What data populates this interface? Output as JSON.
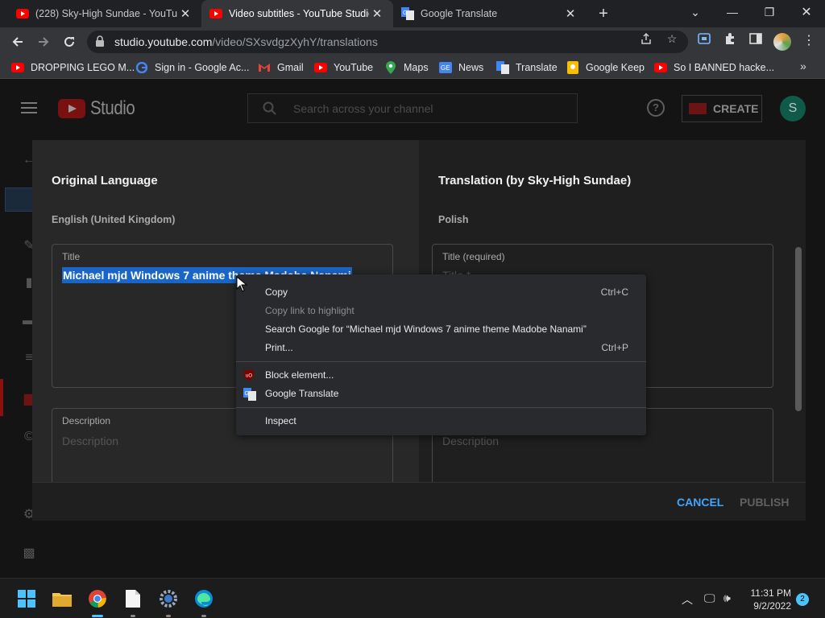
{
  "browser": {
    "tabs": [
      {
        "title": "(228) Sky-High Sundae - YouTube",
        "active": false
      },
      {
        "title": "Video subtitles - YouTube Studio",
        "active": true
      },
      {
        "title": "Google Translate",
        "active": false
      }
    ],
    "url_host": "studio.youtube.com",
    "url_path": "/video/SXsvdgzXyhY/translations",
    "bookmarks": [
      "DROPPING LEGO M...",
      "Sign in - Google Ac...",
      "Gmail",
      "YouTube",
      "Maps",
      "News",
      "Translate",
      "Google Keep",
      "So I BANNED hacke..."
    ]
  },
  "studio": {
    "logo_text": "Studio",
    "search_placeholder": "Search across your channel",
    "create_label": "CREATE",
    "avatar_letter": "S",
    "help_glyph": "?"
  },
  "dialog": {
    "left": {
      "heading": "Original Language",
      "language": "English (United Kingdom)",
      "title_label": "Title",
      "title_value": "Michael mjd Windows 7 anime theme Madobe Nanami",
      "description_label": "Description",
      "description_placeholder": "Description"
    },
    "right": {
      "heading": "Translation (by Sky-High Sundae)",
      "language": "Polish",
      "title_label": "Title (required)",
      "title_placeholder": "Title *",
      "description_placeholder": "Description"
    },
    "cancel_label": "CANCEL",
    "publish_label": "PUBLISH"
  },
  "context_menu": {
    "copy": {
      "label": "Copy",
      "shortcut": "Ctrl+C"
    },
    "copy_link": {
      "label": "Copy link to highlight"
    },
    "search": {
      "label": "Search Google for “Michael mjd Windows 7 anime theme Madobe Nanami”"
    },
    "print": {
      "label": "Print...",
      "shortcut": "Ctrl+P"
    },
    "block": {
      "label": "Block element..."
    },
    "translate": {
      "label": "Google Translate"
    },
    "inspect": {
      "label": "Inspect"
    }
  },
  "taskbar": {
    "time": "11:31 PM",
    "date": "9/2/2022",
    "notification_count": "2"
  },
  "colors": {
    "accent_blue": "#3ea6ff",
    "selection": "#1966c8",
    "youtube_red": "#ff0000"
  }
}
